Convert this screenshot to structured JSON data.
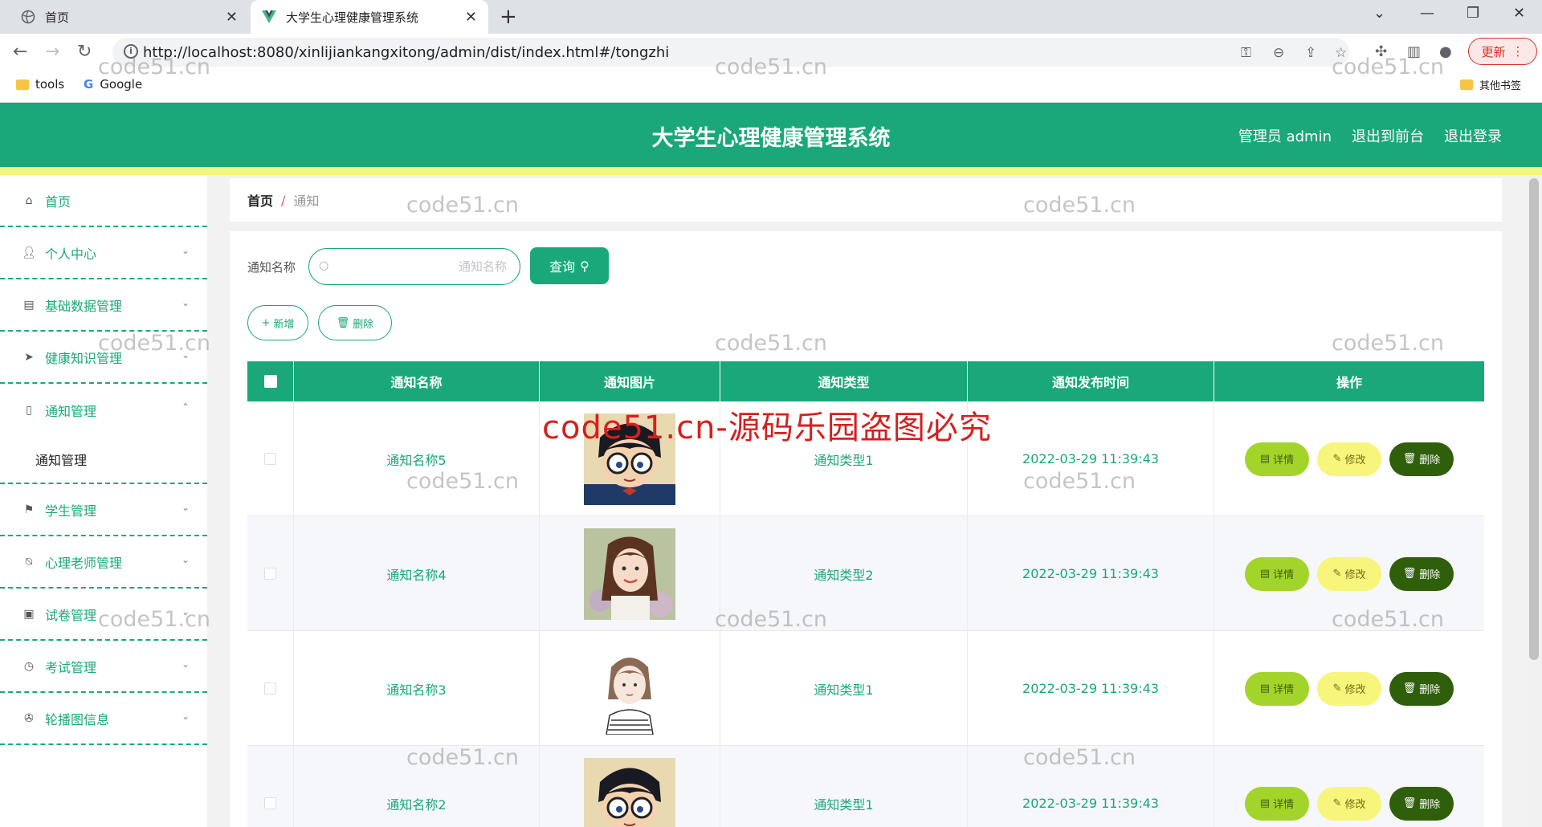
{
  "browser": {
    "tabs": [
      {
        "title": "首页"
      },
      {
        "title": "大学生心理健康管理系统"
      }
    ],
    "url": "http://localhost:8080/xinlijiankangxitong/admin/dist/index.html#/tongzhi",
    "update_label": "更新",
    "bookmarks": [
      {
        "label": "tools"
      },
      {
        "label": "Google"
      }
    ],
    "other_bookmarks": "其他书签"
  },
  "header": {
    "title": "大学生心理健康管理系统",
    "user": "管理员 admin",
    "back_front": "退出到前台",
    "logout": "退出登录"
  },
  "sidebar": {
    "items": [
      {
        "label": "首页",
        "icon": "home-icon"
      },
      {
        "label": "个人中心",
        "icon": "user-icon"
      },
      {
        "label": "基础数据管理",
        "icon": "clipboard-icon"
      },
      {
        "label": "健康知识管理",
        "icon": "paper-plane-icon"
      },
      {
        "label": "通知管理",
        "icon": "bell-icon"
      },
      {
        "label": "学生管理",
        "icon": "flag-icon"
      },
      {
        "label": "心理老师管理",
        "icon": "bell-off-icon"
      },
      {
        "label": "试卷管理",
        "icon": "checklist-icon"
      },
      {
        "label": "考试管理",
        "icon": "clock-icon"
      },
      {
        "label": "轮播图信息",
        "icon": "aperture-icon"
      }
    ],
    "submenu_label": "通知管理"
  },
  "breadcrumb": {
    "home": "首页",
    "separator": "/",
    "current": "通知"
  },
  "search": {
    "label": "通知名称",
    "placeholder": "通知名称",
    "value": "",
    "button": "查询"
  },
  "toolbar": {
    "add": "新增",
    "delete": "删除"
  },
  "table": {
    "columns": [
      "通知名称",
      "通知图片",
      "通知类型",
      "通知发布时间",
      "操作"
    ],
    "rows": [
      {
        "name": "通知名称5",
        "image": "cartoon-boy-glasses",
        "type": "通知类型1",
        "time": "2022-03-29 11:39:43"
      },
      {
        "name": "通知名称4",
        "image": "girl-photo",
        "type": "通知类型2",
        "time": "2022-03-29 11:39:43"
      },
      {
        "name": "通知名称3",
        "image": "sketch-girl",
        "type": "通知类型1",
        "time": "2022-03-29 11:39:43"
      },
      {
        "name": "通知名称2",
        "image": "cartoon-boy-glasses",
        "type": "通知类型1",
        "time": "2022-03-29 11:39:43"
      }
    ],
    "actions": {
      "detail": "详情",
      "edit": "修改",
      "delete": "删除"
    }
  },
  "watermarks": {
    "text": "code51.cn",
    "red": "code51.cn-源码乐园盗图必究"
  },
  "colors": {
    "primary": "#1aa87a",
    "header_strip": "#f3f67a",
    "detail_btn": "#a3d42a",
    "edit_btn": "#f7f57b",
    "delete_btn": "#2f5f0b"
  }
}
